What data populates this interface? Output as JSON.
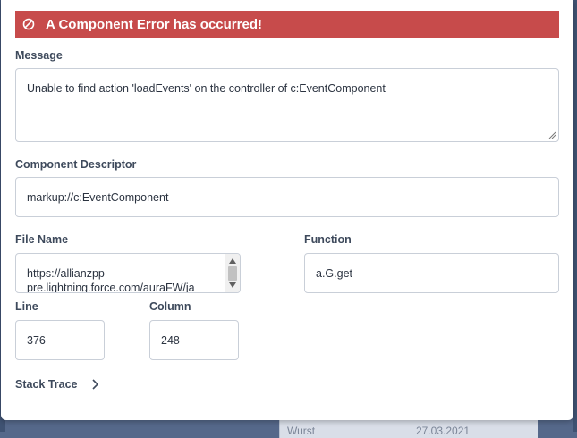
{
  "error_banner": {
    "title": "A Component Error has occurred!",
    "icon": "prohibited-icon",
    "color": "#c74b4b"
  },
  "message": {
    "label": "Message",
    "value": "Unable to find action 'loadEvents' on the controller of c:EventComponent"
  },
  "component_descriptor": {
    "label": "Component Descriptor",
    "value": "markup://c:EventComponent"
  },
  "file_name": {
    "label": "File Name",
    "value": "https://allianzpp--\npre.lightning.force.com/auraFW/ja"
  },
  "function": {
    "label": "Function",
    "value": "a.G.get"
  },
  "line": {
    "label": "Line",
    "value": "376"
  },
  "column": {
    "label": "Column",
    "value": "248"
  },
  "stack_trace": {
    "label": "Stack Trace",
    "icon": "chevron-right-icon"
  },
  "background_row": {
    "name": "Wurst",
    "date": "27.03.2021"
  }
}
